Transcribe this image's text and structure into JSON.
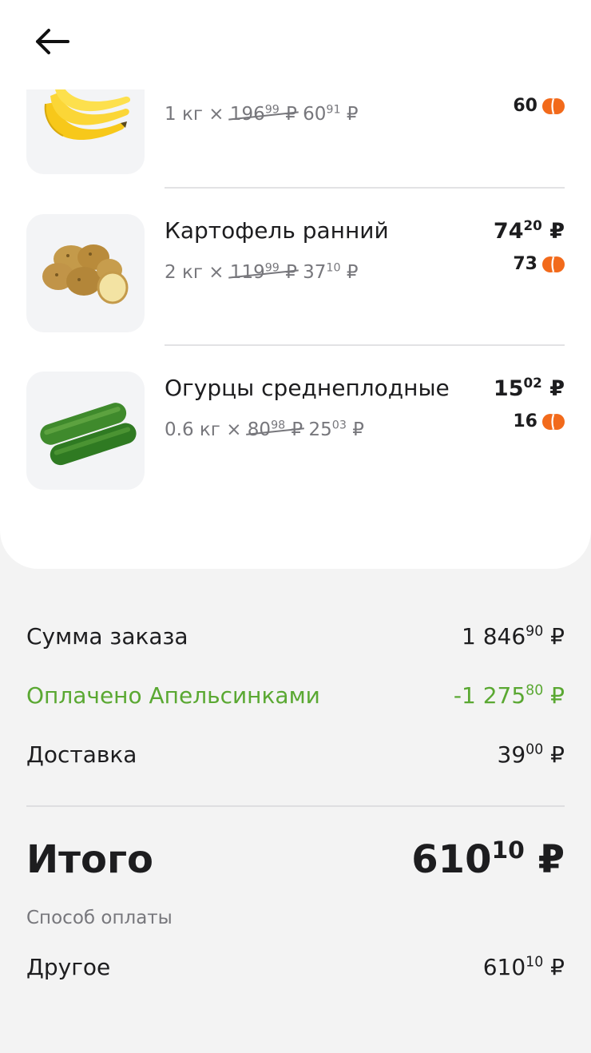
{
  "nav": {
    "back_label": "back"
  },
  "items": [
    {
      "name": "",
      "qty": "1 кг",
      "times": "×",
      "old_int": "196",
      "old_dec": "99",
      "new_int": "60",
      "new_dec": "91",
      "price_int": "",
      "price_dec": "",
      "bonus": "60",
      "image": "banana"
    },
    {
      "name": "Картофель ранний",
      "qty": "2 кг",
      "times": "×",
      "old_int": "119",
      "old_dec": "99",
      "new_int": "37",
      "new_dec": "10",
      "price_int": "74",
      "price_dec": "20",
      "bonus": "73",
      "image": "potato"
    },
    {
      "name": "Огурцы среднеплодные",
      "qty": "0.6 кг",
      "times": "×",
      "old_int": "80",
      "old_dec": "98",
      "new_int": "25",
      "new_dec": "03",
      "price_int": "15",
      "price_dec": "02",
      "bonus": "16",
      "image": "cucumber"
    }
  ],
  "currency": "₽",
  "summary": {
    "order_sum_label": "Сумма заказа",
    "order_sum_int": "1 846",
    "order_sum_dec": "90",
    "paid_label": "Оплачено Апельсинками",
    "paid_int": "-1 275",
    "paid_dec": "80",
    "delivery_label": "Доставка",
    "delivery_int": "39",
    "delivery_dec": "00",
    "total_label": "Итого",
    "total_int": "610",
    "total_dec": "10",
    "payment_method_label": "Способ оплаты",
    "payment_method": "Другое",
    "payment_int": "610",
    "payment_dec": "10"
  },
  "colors": {
    "accent_green": "#5aa832",
    "bonus_orange": "#f26a1b"
  }
}
